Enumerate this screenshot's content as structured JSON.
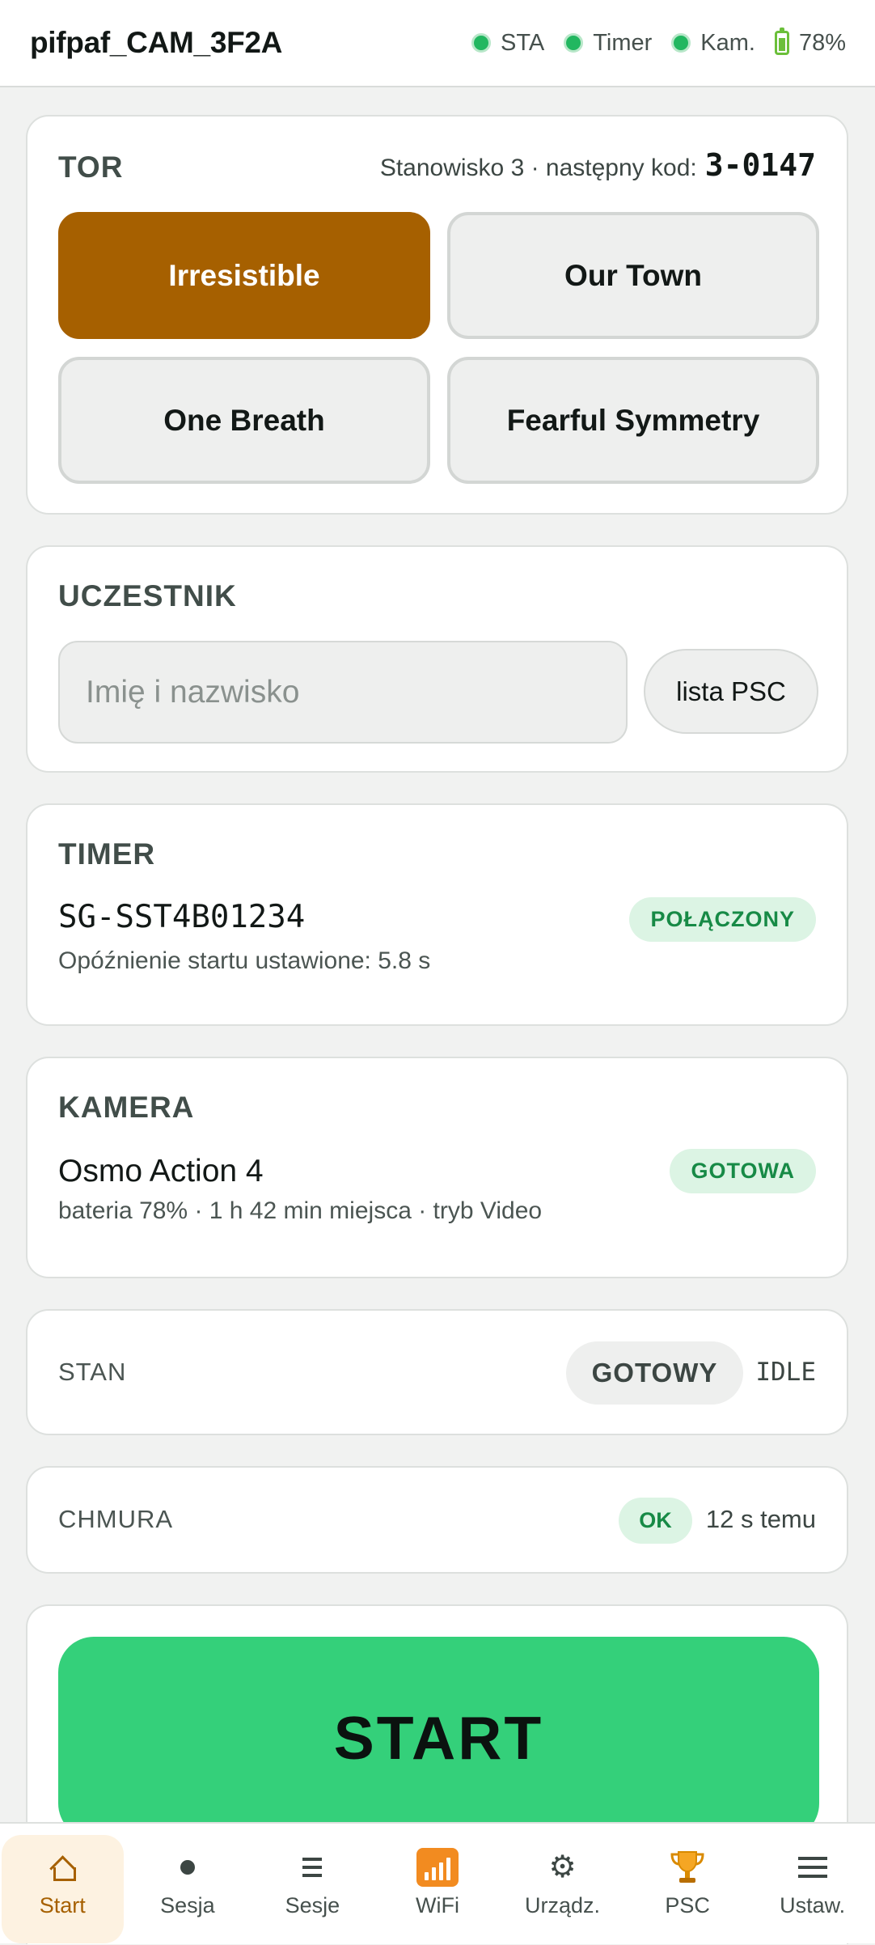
{
  "header": {
    "title": "pifpaf_CAM_3F2A",
    "status": [
      {
        "label": "STA",
        "color": "#22b760"
      },
      {
        "label": "Timer",
        "color": "#22b760"
      },
      {
        "label": "Kam.",
        "color": "#22b760"
      }
    ],
    "battery": "78%"
  },
  "tor": {
    "title": "TOR",
    "lane_prefix": "Stanowisko 3 · następny kod:",
    "next_code": "3-0147",
    "tracks": [
      "Irresistible",
      "Our Town",
      "One Breath",
      "Fearful Symmetry"
    ],
    "selected_track": "Irresistible"
  },
  "participant": {
    "title": "UCZESTNIK",
    "name_value": "",
    "name_placeholder": "Imię i nazwisko",
    "psc_list_label": "lista PSC"
  },
  "timer": {
    "title": "TIMER",
    "device_id": "SG-SST4B01234",
    "status": "POŁĄCZONY",
    "detail": "Opóźnienie startu ustawione: 5.8 s"
  },
  "camera": {
    "title": "KAMERA",
    "model": "Osmo Action 4",
    "status": "GOTOWA",
    "detail": "bateria 78% · 1 h 42 min miejsca · tryb Video"
  },
  "state": {
    "label": "STAN",
    "badge": "GOTOWY",
    "code": "IDLE"
  },
  "cloud": {
    "label": "CHMURA",
    "status": "OK",
    "last_sync": "12 s temu"
  },
  "start": {
    "label": "START"
  },
  "nav": {
    "items": [
      {
        "label": "Start",
        "icon": "home-icon",
        "active": true
      },
      {
        "label": "Sesja",
        "icon": "record-dot-icon"
      },
      {
        "label": "Sesje",
        "icon": "list-icon"
      },
      {
        "label": "WiFi",
        "icon": "signal-bars-icon"
      },
      {
        "label": "Urządz.",
        "icon": "gear-icon"
      },
      {
        "label": "PSC",
        "icon": "trophy-icon"
      },
      {
        "label": "Ustaw.",
        "icon": "menu-icon"
      }
    ]
  },
  "colors": {
    "accent": "#a66000",
    "start": "#34d07a",
    "ok_bg": "#dcf4e4",
    "ok_text": "#178a46"
  }
}
